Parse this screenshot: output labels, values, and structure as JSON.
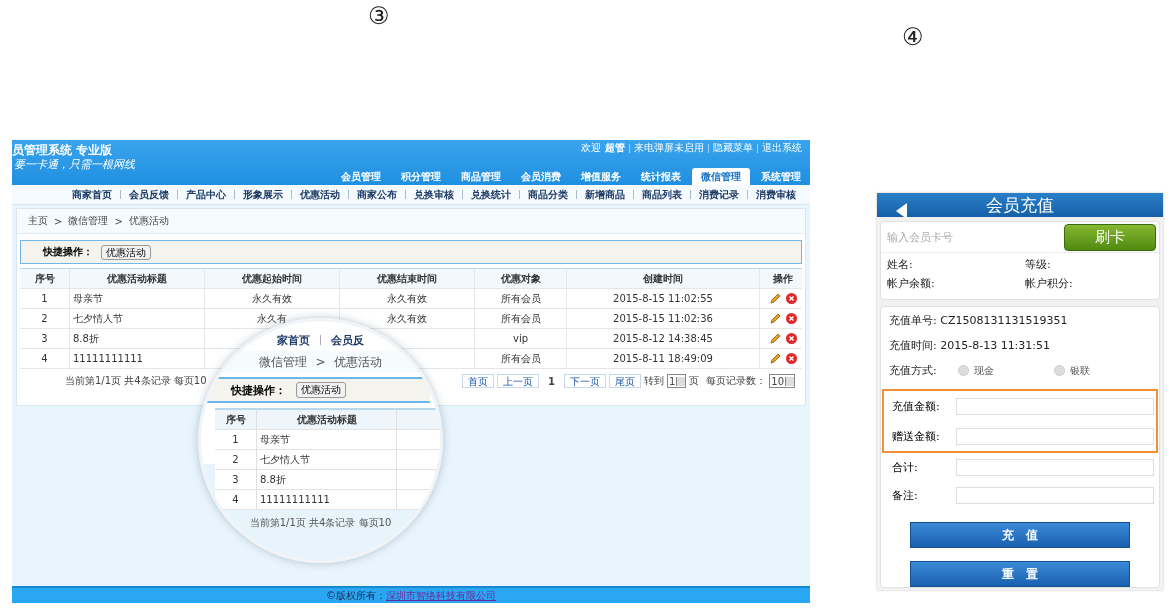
{
  "markers": [
    "③",
    "④"
  ],
  "admin": {
    "title": "员管理系统 专业版",
    "slogan": "要一卡通，只需一根网线",
    "top_links": [
      {
        "text": "欢迎",
        "kind": "plain"
      },
      {
        "text": "超管",
        "kind": "user"
      },
      {
        "text": "来电弹屏未启用",
        "kind": "link"
      },
      {
        "text": "隐藏菜单",
        "kind": "link"
      },
      {
        "text": "退出系统",
        "kind": "link"
      }
    ],
    "tabs": [
      {
        "label": "会员管理",
        "selected": false
      },
      {
        "label": "积分管理",
        "selected": false
      },
      {
        "label": "商品管理",
        "selected": false
      },
      {
        "label": "会员消费",
        "selected": false
      },
      {
        "label": "增值服务",
        "selected": false
      },
      {
        "label": "统计报表",
        "selected": false
      },
      {
        "label": "微信管理",
        "selected": true
      },
      {
        "label": "系统管理",
        "selected": false
      }
    ],
    "subnav": [
      "商家首页",
      "会员反馈",
      "产品中心",
      "形象展示",
      "优惠活动",
      "商家公布",
      "兑换审核",
      "兑换统计",
      "商品分类",
      "新增商品",
      "商品列表",
      "消费记录",
      "消费审核"
    ],
    "breadcrumb": [
      "主页",
      ">",
      "微信管理",
      ">",
      "优惠活动"
    ],
    "quick_ops": {
      "label": "快捷操作：",
      "button": "优惠活动"
    },
    "table": {
      "columns": [
        "序号",
        "优惠活动标题",
        "优惠起始时间",
        "优惠结束时间",
        "优惠对象",
        "创建时间",
        "操作"
      ],
      "rows": [
        {
          "no": "1",
          "title": "母亲节",
          "start": "永久有效",
          "end": "永久有效",
          "target": "所有会员",
          "created": "2015-8-15 11:02:55"
        },
        {
          "no": "2",
          "title": "七夕情人节",
          "start": "永久有",
          "end": "永久有效",
          "target": "所有会员",
          "created": "2015-8-15 11:02:36"
        },
        {
          "no": "3",
          "title": "8.8折",
          "target": "vip",
          "created": "2015-8-12 14:38:45"
        },
        {
          "no": "4",
          "title": "11111111111",
          "target": "所有会员",
          "created": "2015-8-11 18:49:09"
        }
      ]
    },
    "pager": {
      "summary": "当前第1/1页 共4条记录 每页10",
      "buttons": [
        "首页",
        "上一页"
      ],
      "current": "1",
      "buttons2": [
        "下一页",
        "尾页"
      ],
      "goto_label": "转到",
      "goto_value": "1",
      "page_suffix": "页",
      "size_label": "每页记录数：",
      "size_value": "10"
    },
    "footer": {
      "text": "©版权所有：",
      "link": "深圳市智络科技有限公司"
    },
    "magnifier": {
      "nav_fragments": [
        "家首页",
        "会员反"
      ],
      "breadcrumb": [
        "微信管理",
        ">",
        "优惠活动"
      ],
      "quick_label": "快捷操作：",
      "quick_button": "优惠活动",
      "columns": [
        "序号",
        "优惠活动标题"
      ],
      "rows": [
        {
          "no": "1",
          "title": "母亲节"
        },
        {
          "no": "2",
          "title": "七夕情人节"
        },
        {
          "no": "3",
          "title": "8.8折"
        },
        {
          "no": "4",
          "title": "11111111111"
        }
      ],
      "summary": "当前第1/1页 共4条记录 每页10"
    }
  },
  "phone": {
    "title": "会员充值",
    "card_placeholder": "输入会员卡号",
    "swipe_button": "刷卡",
    "info": [
      "姓名:",
      "等级:",
      "帐户余额:",
      "帐户积分:"
    ],
    "order_no": "充值单号: CZ1508131131519351",
    "time": "充值时间: 2015-8-13 11:31:51",
    "method_label": "充值方式:",
    "methods": [
      {
        "label": "现金",
        "checked": false
      },
      {
        "label": "银联",
        "checked": false
      }
    ],
    "fields": [
      {
        "label": "充值金额:",
        "highlighted": true
      },
      {
        "label": "赠送金额:",
        "highlighted": true
      },
      {
        "label": "合计:",
        "highlighted": false
      },
      {
        "label": "备注:",
        "highlighted": false
      }
    ],
    "buttons": [
      "充　值",
      "重　置"
    ]
  }
}
